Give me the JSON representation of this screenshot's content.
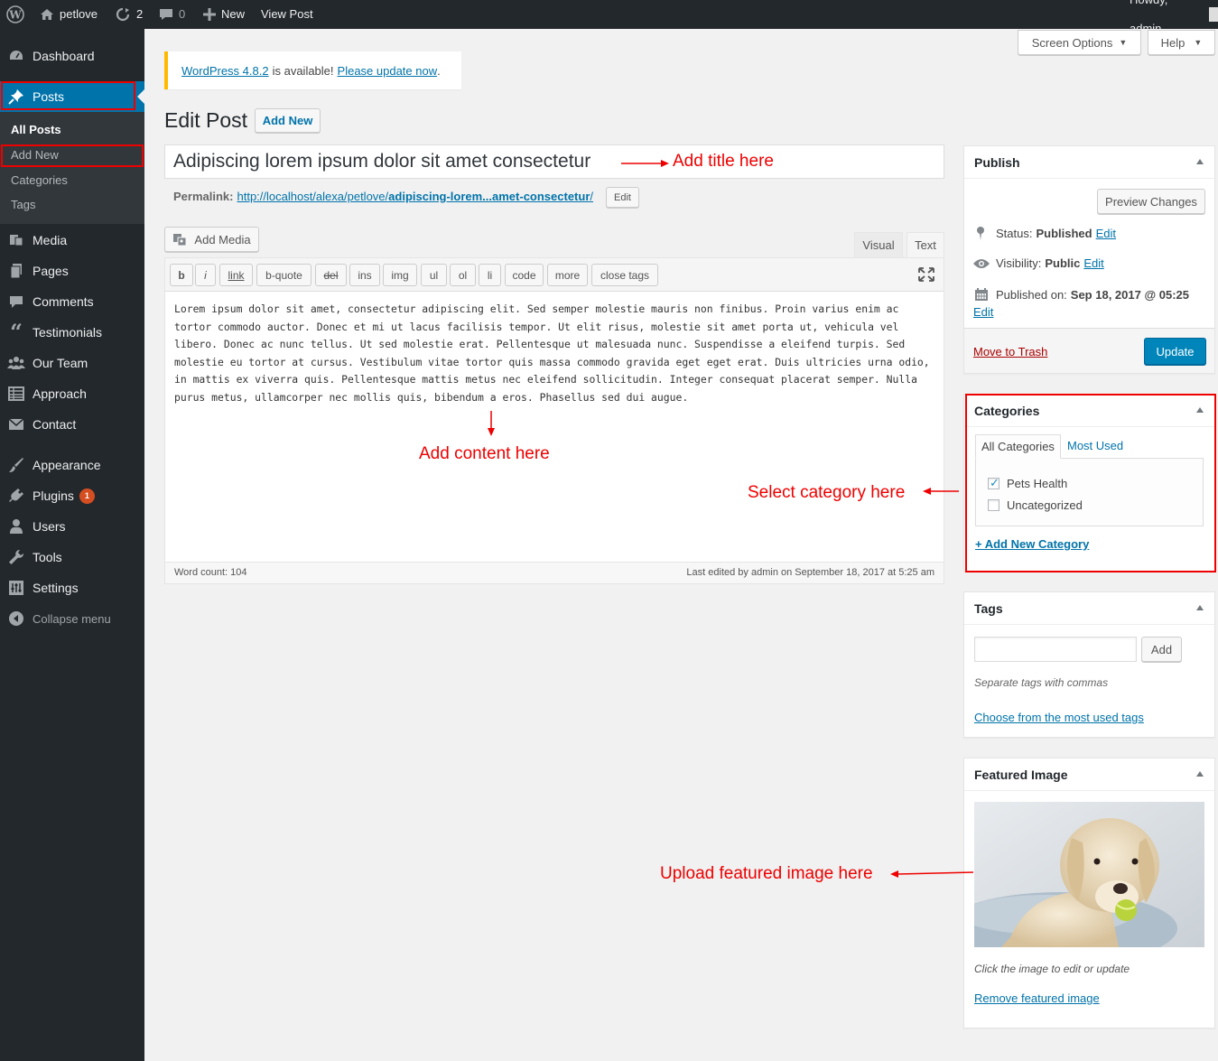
{
  "admin_bar": {
    "site_name": "petlove",
    "updates_count": "2",
    "comments_count": "0",
    "new_label": "New",
    "view_post_label": "View Post",
    "howdy": "Howdy, admin"
  },
  "sidebar": {
    "dashboard": "Dashboard",
    "posts": "Posts",
    "submenu": {
      "all_posts": "All Posts",
      "add_new": "Add New",
      "categories": "Categories",
      "tags": "Tags"
    },
    "media": "Media",
    "pages": "Pages",
    "comments": "Comments",
    "testimonials": "Testimonials",
    "our_team": "Our Team",
    "approach": "Approach",
    "contact": "Contact",
    "appearance": "Appearance",
    "plugins": "Plugins",
    "plugins_badge": "1",
    "users": "Users",
    "tools": "Tools",
    "settings": "Settings",
    "collapse": "Collapse menu"
  },
  "screen_meta": {
    "screen_options": "Screen Options",
    "help": "Help"
  },
  "notice": {
    "link1": "WordPress 4.8.2",
    "middle": "is available!",
    "link2": "Please update now",
    "end": "."
  },
  "heading": {
    "title": "Edit Post",
    "add_new": "Add New"
  },
  "post": {
    "title": "Adipiscing lorem ipsum dolor sit amet consectetur",
    "permalink_label": "Permalink:",
    "permalink_base": "http://localhost/alexa/petlove/",
    "permalink_slug": "adipiscing-lorem...amet-consectetur",
    "permalink_end": "/",
    "permalink_edit": "Edit",
    "content": "Lorem ipsum dolor sit amet, consectetur adipiscing elit. Sed semper molestie mauris non finibus. Proin varius enim ac tortor commodo auctor. Donec et mi ut lacus facilisis tempor. Ut elit risus, molestie sit amet porta ut, vehicula vel libero. Donec ac nunc tellus. Ut sed molestie erat. Pellentesque ut malesuada nunc. Suspendisse a eleifend turpis. Sed molestie eu tortor at cursus. Vestibulum vitae tortor quis massa commodo gravida eget eget erat. Duis ultricies urna odio, in mattis ex viverra quis. Pellentesque mattis metus nec eleifend sollicitudin. Integer consequat placerat semper. Nulla purus metus, ullamcorper nec mollis quis, bibendum a eros. Phasellus sed dui augue."
  },
  "editor": {
    "add_media": "Add Media",
    "tab_visual": "Visual",
    "tab_text": "Text",
    "quicktags": [
      "b",
      "i",
      "link",
      "b-quote",
      "del",
      "ins",
      "img",
      "ul",
      "ol",
      "li",
      "code",
      "more",
      "close tags"
    ],
    "word_count": "Word count: 104",
    "last_edited": "Last edited by admin on September 18, 2017 at 5:25 am"
  },
  "publish": {
    "title": "Publish",
    "preview": "Preview Changes",
    "status_label": "Status:",
    "status_value": "Published",
    "visibility_label": "Visibility:",
    "visibility_value": "Public",
    "published_on_label": "Published on:",
    "published_on_value": "Sep 18, 2017 @ 05:25",
    "edit": "Edit",
    "move_to_trash": "Move to Trash",
    "update": "Update"
  },
  "categories": {
    "title": "Categories",
    "tab_all": "All Categories",
    "tab_most_used": "Most Used",
    "items": [
      {
        "label": "Pets Health",
        "checked": true
      },
      {
        "label": "Uncategorized",
        "checked": false
      }
    ],
    "add_new": "+ Add New Category"
  },
  "tags": {
    "title": "Tags",
    "input_value": "",
    "add": "Add",
    "hint": "Separate tags with commas",
    "choose": "Choose from the most used tags"
  },
  "featured_image": {
    "title": "Featured Image",
    "hint": "Click the image to edit or update",
    "remove": "Remove featured image"
  },
  "annotations": {
    "title": "Add title here",
    "content": "Add content here",
    "category": "Select category here",
    "image": "Upload featured image here"
  },
  "colors": {
    "accent": "#0073aa",
    "sidebar_bg": "#23282d",
    "annotation": "#e00000",
    "update_button": "#0085ba",
    "notice_border": "#ffb900"
  }
}
